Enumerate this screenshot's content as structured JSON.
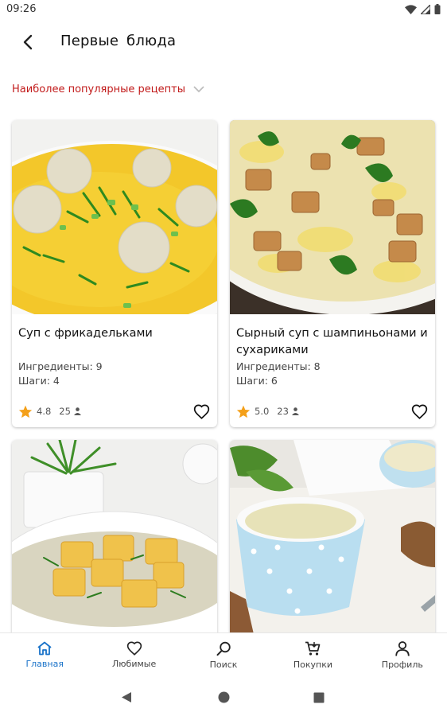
{
  "status_bar": {
    "time": "09:26"
  },
  "header": {
    "title": "Первые  блюда"
  },
  "sort": {
    "label": "Наиболее популярные рецепты"
  },
  "recipes": [
    {
      "title": "Суп с фрикадельками",
      "ingredients": "Ингредиенты: 9",
      "steps": "Шаги: 4",
      "rating": "4.8",
      "reviews": "25"
    },
    {
      "title": "Сырный суп с шампиньонами и сухариками",
      "ingredients": "Ингредиенты: 8",
      "steps": "Шаги: 6",
      "rating": "5.0",
      "reviews": "23"
    },
    {
      "title": ""
    },
    {
      "title": ""
    }
  ],
  "nav": {
    "items": [
      {
        "label": "Главная",
        "icon": "home-icon"
      },
      {
        "label": "Любимые",
        "icon": "heart-icon"
      },
      {
        "label": "Поиск",
        "icon": "search-icon"
      },
      {
        "label": "Покупки",
        "icon": "cart-icon"
      },
      {
        "label": "Профиль",
        "icon": "person-icon"
      }
    ],
    "active_index": 0
  },
  "colors": {
    "accent": "#1a73c9",
    "sort_label": "#c21b1b",
    "star": "#f4a01a"
  }
}
